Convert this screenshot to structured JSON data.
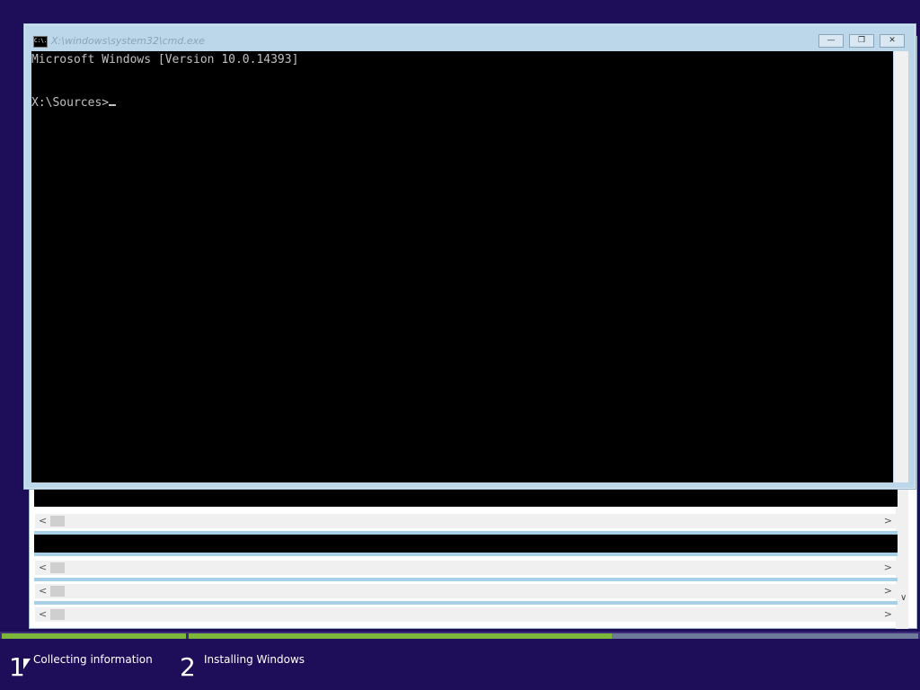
{
  "cmd_window": {
    "title": "X:\\windows\\system32\\cmd.exe",
    "icon_text": "C:\\.",
    "controls": {
      "minimize": "—",
      "restore": "❐",
      "close": "✕"
    },
    "console_lines": [
      "Microsoft Windows [Version 10.0.14393]",
      "X:\\Sources>"
    ]
  },
  "side_close_glyph": "✕",
  "scroll_arrows": {
    "left": "<",
    "right": ">",
    "down": "∨"
  },
  "setup_steps": [
    {
      "number": "1",
      "label": "Collecting information"
    },
    {
      "number": "2",
      "label": "Installing Windows"
    }
  ],
  "colors": {
    "background": "#1e0e5a",
    "progress_done": "#7eb63c",
    "progress_pending": "#6e7a9a"
  }
}
